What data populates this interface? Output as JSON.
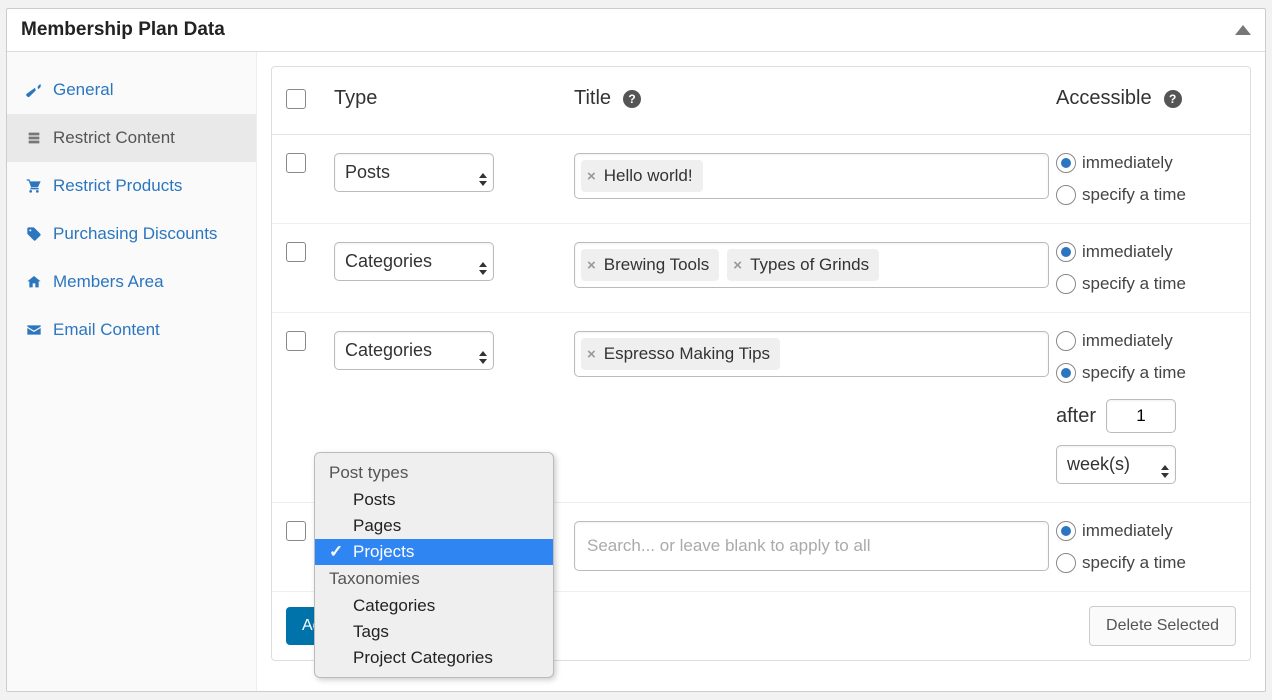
{
  "panel_title": "Membership Plan Data",
  "sidebar": {
    "items": [
      {
        "label": "General"
      },
      {
        "label": "Restrict Content"
      },
      {
        "label": "Restrict Products"
      },
      {
        "label": "Purchasing Discounts"
      },
      {
        "label": "Members Area"
      },
      {
        "label": "Email Content"
      }
    ]
  },
  "columns": {
    "type": "Type",
    "title": "Title",
    "accessible": "Accessible"
  },
  "rows": [
    {
      "type": "Posts",
      "tags": [
        "Hello world!"
      ],
      "accessible": {
        "selected": "immediately",
        "options": {
          "immediately": "immediately",
          "specify": "specify a time"
        }
      }
    },
    {
      "type": "Categories",
      "tags": [
        "Brewing Tools",
        "Types of Grinds"
      ],
      "accessible": {
        "selected": "immediately",
        "options": {
          "immediately": "immediately",
          "specify": "specify a time"
        }
      }
    },
    {
      "type": "Categories",
      "tags": [
        "Espresso Making Tips"
      ],
      "accessible": {
        "selected": "specify",
        "options": {
          "immediately": "immediately",
          "specify": "specify a time"
        },
        "after_label": "after",
        "after_value": "1",
        "unit": "week(s)"
      }
    },
    {
      "type": "",
      "search_placeholder": "Search... or leave blank to apply to all",
      "accessible": {
        "selected": "immediately",
        "options": {
          "immediately": "immediately",
          "specify": "specify a time"
        }
      }
    }
  ],
  "dropdown": {
    "groups": [
      {
        "label": "Post types",
        "options": [
          "Posts",
          "Pages",
          "Projects"
        ]
      },
      {
        "label": "Taxonomies",
        "options": [
          "Categories",
          "Tags",
          "Project Categories"
        ]
      }
    ],
    "selected": "Projects"
  },
  "footer": {
    "add": "Add",
    "delete": "Delete Selected"
  },
  "help_tip": "?"
}
